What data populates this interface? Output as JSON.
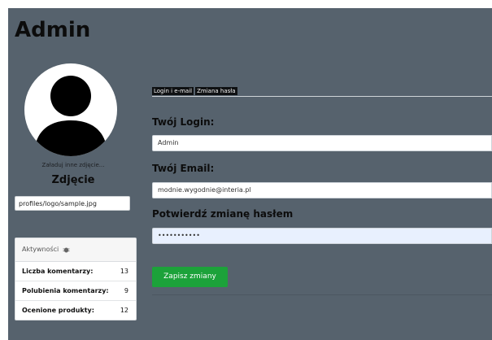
{
  "page": {
    "title": "Admin"
  },
  "profile": {
    "upload_link": "Załaduj inne zdjęcie...",
    "photo_label": "Zdjęcie",
    "photo_path": "profiles/logo/sample.jpg"
  },
  "activity": {
    "header": "Aktywności",
    "stats": [
      {
        "label": "Liczba komentarzy:",
        "value": "13"
      },
      {
        "label": "Polubienia komentarzy:",
        "value": "9"
      },
      {
        "label": "Ocenione produkty:",
        "value": "12"
      }
    ]
  },
  "tabs": [
    {
      "label": "Login i e-mail"
    },
    {
      "label": "Zmiana hasła"
    }
  ],
  "form": {
    "login_label": "Twój Login:",
    "login_value": "Admin",
    "email_label": "Twój Email:",
    "email_value": "modnie.wygodnie@interia.pl",
    "password_label": "Potwierdź zmianę hasłem",
    "password_value": "•••••••••••",
    "save_label": "Zapisz zmiany"
  },
  "colors": {
    "background": "#56626d",
    "save_button": "#1ca23a",
    "password_autofill": "#e8f0fe"
  },
  "icons": {
    "activity": "bug-icon"
  }
}
